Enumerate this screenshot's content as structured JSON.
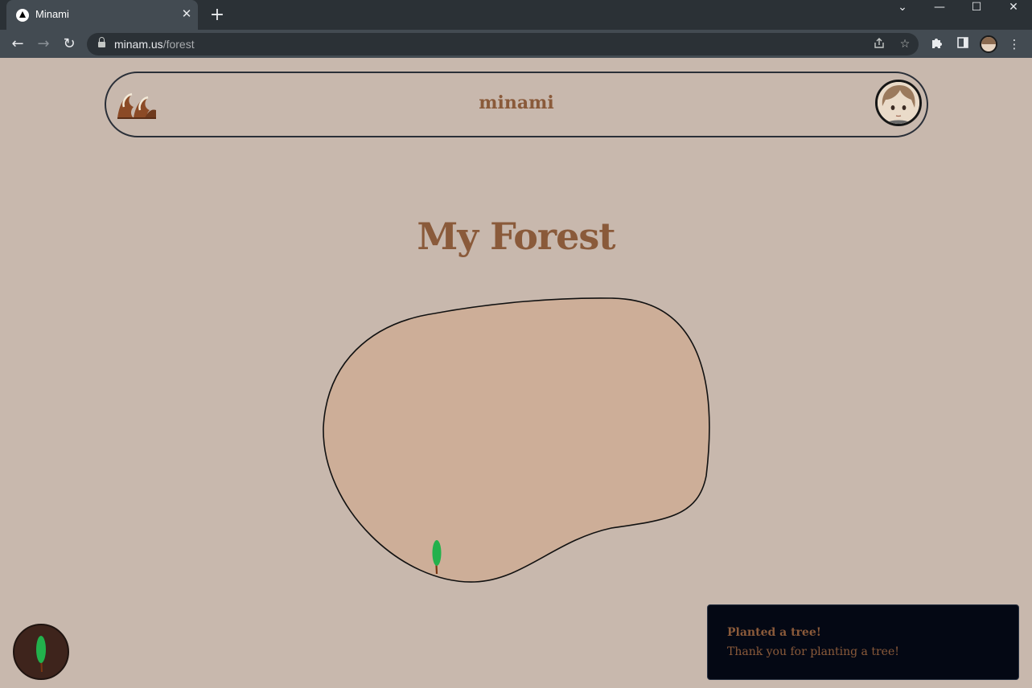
{
  "browser": {
    "tab_title": "Minami",
    "tab_close": "✕",
    "new_tab": "+",
    "url_domain": "minam.us",
    "url_path": "/forest",
    "window_controls": {
      "dropdown": "⌄",
      "minimize": "—",
      "maximize": "☐",
      "close": "✕"
    },
    "nav": {
      "back": "←",
      "forward": "→",
      "reload": "↻"
    },
    "icons": {
      "share": "share-icon",
      "star": "☆",
      "extensions": "puzzle-icon",
      "side_panel": "side-panel-icon",
      "menu": "⋮"
    }
  },
  "header": {
    "site_title": "minami",
    "logo": "wave-logo",
    "avatar": "profile-avatar"
  },
  "main": {
    "heading": "My Forest",
    "island_fill": "#cdae98",
    "tree_color": "#22b14c"
  },
  "plant_button": {
    "icon": "tree-icon"
  },
  "toast": {
    "title": "Planted a tree!",
    "body": "Thank you for planting a tree!"
  }
}
